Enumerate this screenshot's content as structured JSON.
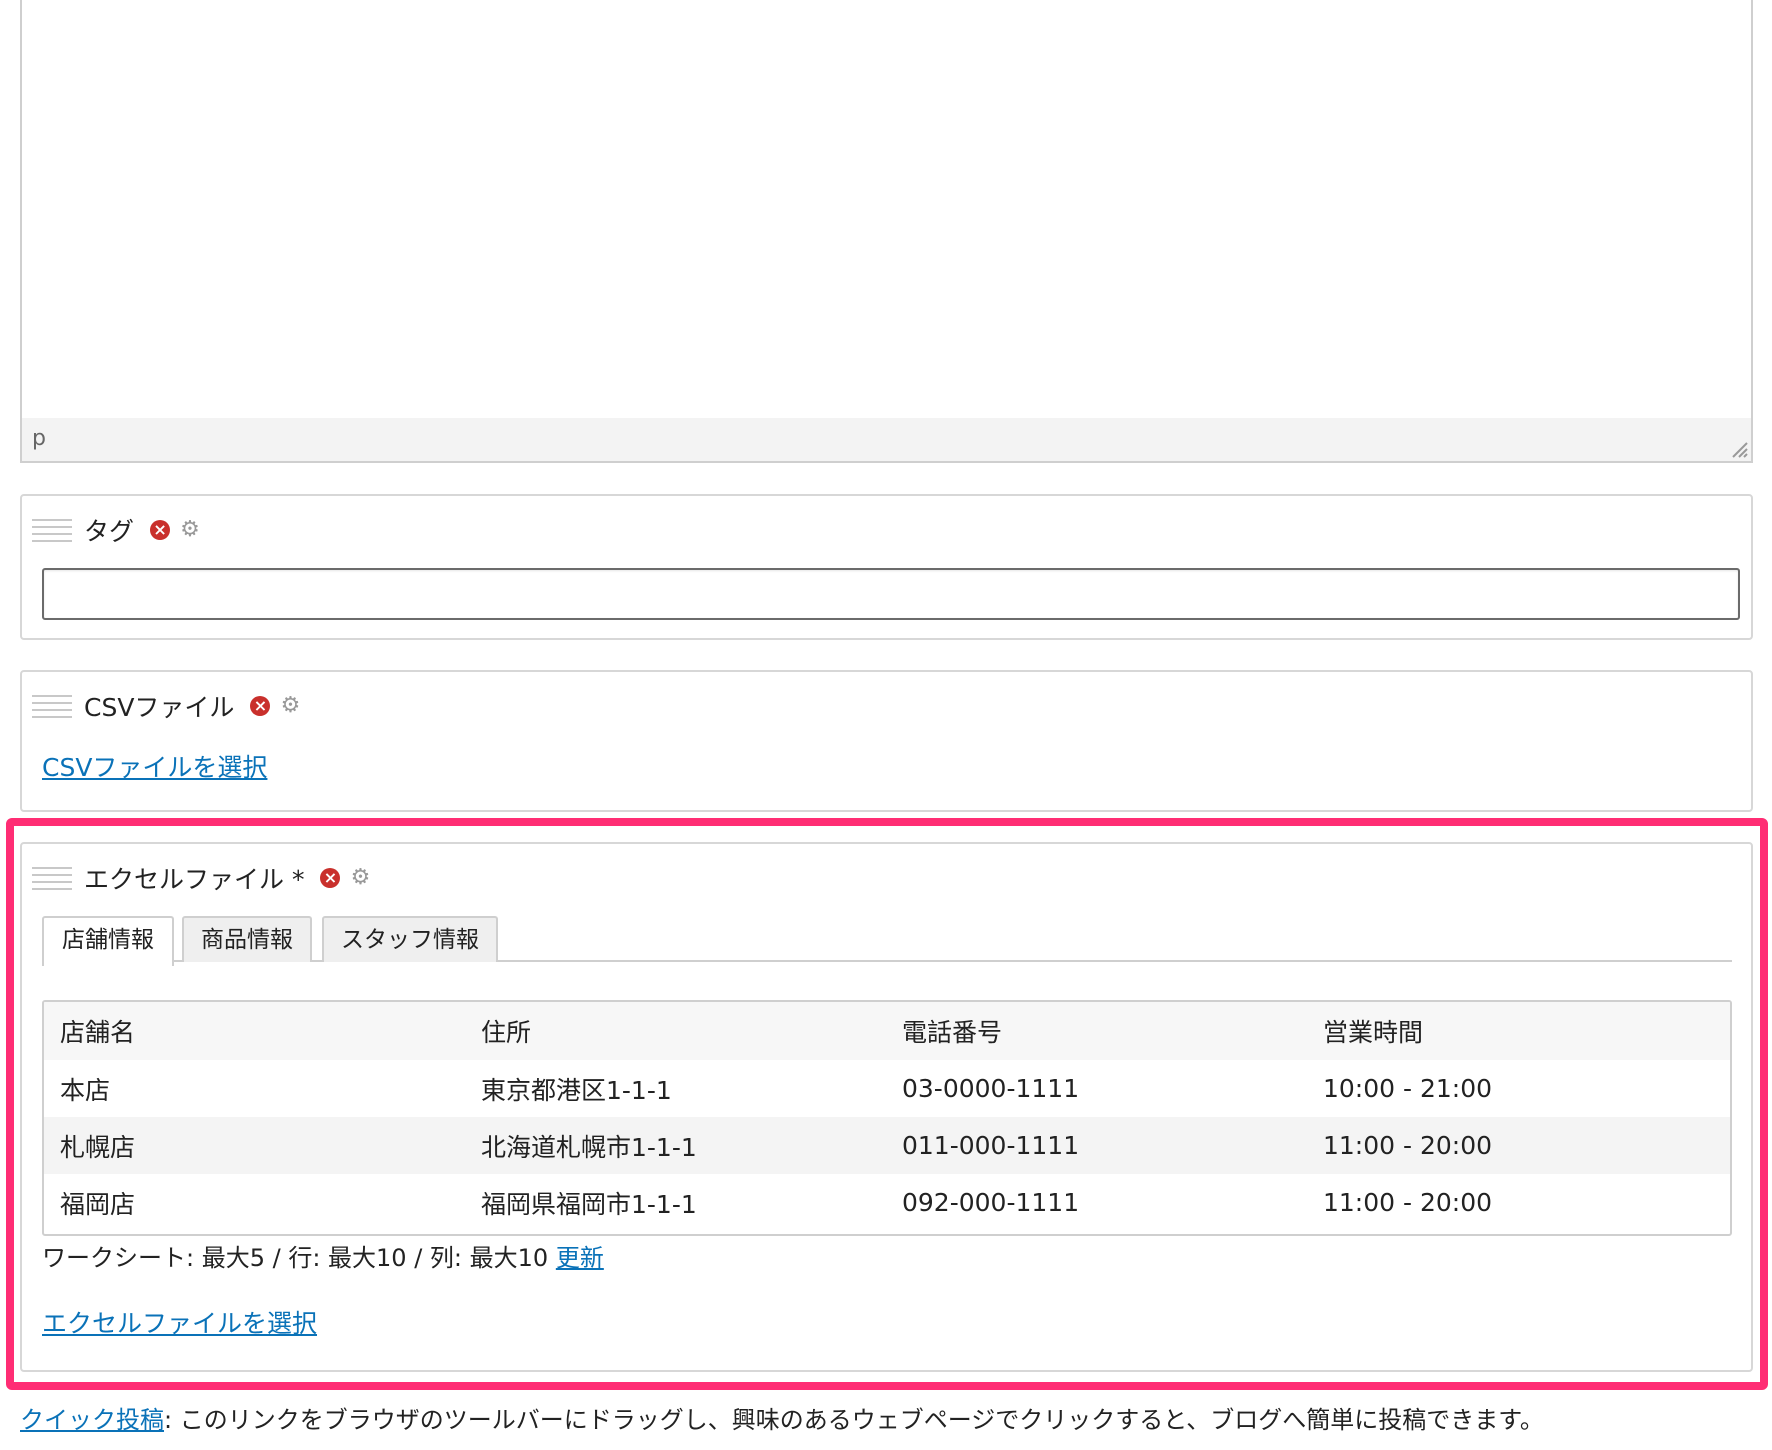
{
  "editor": {
    "path_label": "p"
  },
  "tags_field": {
    "title": "タグ",
    "input_value": ""
  },
  "csv_field": {
    "title": "CSVファイル",
    "select_link": "CSVファイルを選択"
  },
  "excel_field": {
    "title": "エクセルファイル *",
    "tabs": [
      {
        "label": "店舗情報",
        "active": true
      },
      {
        "label": "商品情報",
        "active": false
      },
      {
        "label": "スタッフ情報",
        "active": false
      }
    ],
    "table": {
      "headers": [
        "店舗名",
        "住所",
        "電話番号",
        "営業時間"
      ],
      "rows": [
        [
          "本店",
          "東京都港区1-1-1",
          "03-0000-1111",
          "10:00 - 21:00"
        ],
        [
          "札幌店",
          "北海道札幌市1-1-1",
          "011-000-1111",
          "11:00 - 20:00"
        ],
        [
          "福岡店",
          "福岡県福岡市1-1-1",
          "092-000-1111",
          "11:00 - 20:00"
        ]
      ]
    },
    "limits_text": "ワークシート: 最大5 / 行: 最大10 / 列: 最大10",
    "update_link": "更新",
    "select_link": "エクセルファイルを選択"
  },
  "footer": {
    "quick_post_link": "クイック投稿",
    "quick_post_text": ": このリンクをブラウザのツールバーにドラッグし、興味のあるウェブページでクリックすると、ブログへ簡単に投稿できます。"
  },
  "icons": {
    "remove": "remove-icon",
    "gear": "gear-icon",
    "handle": "drag-handle-icon"
  },
  "colors": {
    "highlight": "#ff2d74",
    "link": "#0a72b8",
    "remove": "#c9302c"
  }
}
